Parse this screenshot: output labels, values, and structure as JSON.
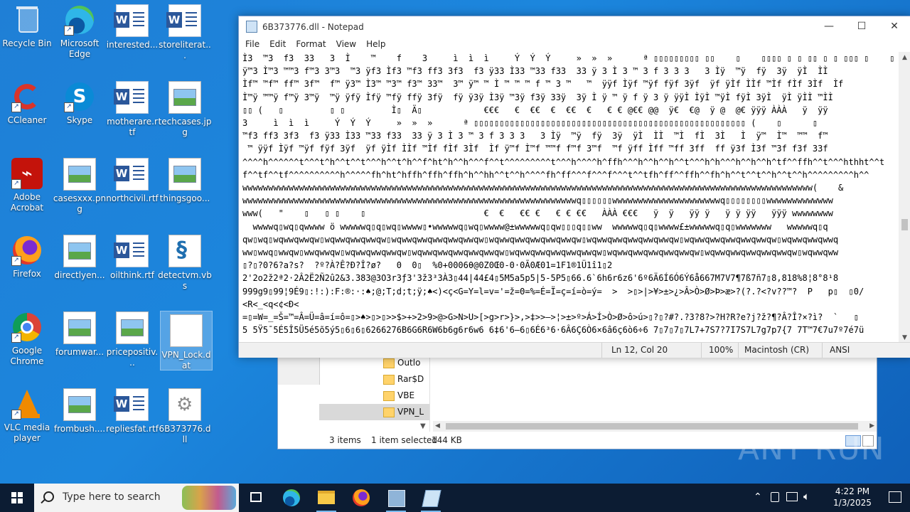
{
  "desktop": {
    "icons": [
      {
        "label": "Recycle Bin"
      },
      {
        "label": "Microsoft Edge"
      },
      {
        "label": "interested..."
      },
      {
        "label": "storeliterat..."
      },
      {
        "label": "CCleaner"
      },
      {
        "label": "Skype"
      },
      {
        "label": "motherare.rtf"
      },
      {
        "label": "techcases.jpg"
      },
      {
        "label": "Adobe Acrobat"
      },
      {
        "label": "casesxxx.png"
      },
      {
        "label": "northcivil.rtf"
      },
      {
        "label": "thingsgoo..."
      },
      {
        "label": "Firefox"
      },
      {
        "label": "directlyen..."
      },
      {
        "label": "oilthink.rtf"
      },
      {
        "label": "detectvm.vbs"
      },
      {
        "label": "Google Chrome"
      },
      {
        "label": "forumwar..."
      },
      {
        "label": "pricepositiv..."
      },
      {
        "label": "VPN_Lock.dat"
      },
      {
        "label": "VLC media player"
      },
      {
        "label": "frombush...."
      },
      {
        "label": "repliesfat.rtf"
      },
      {
        "label": "6B373776.dll"
      }
    ]
  },
  "notepad": {
    "title": "6B373776.dll - Notepad",
    "menu": [
      "File",
      "Edit",
      "Format",
      "View",
      "Help"
    ],
    "controls": {
      "minimize": "—",
      "maximize": "☐",
      "close": "✕"
    },
    "lines": [
      "Ì3  ™3  f3  33   3  Ì    ™    f    3     ì  ì  ì     Ý  Ý  Ý     »  »  »      ª ▯▯▯▯▯▯▯▯▯ ▯▯    ▯    ▯▯▯▯ ▯ ▯ ▯▯ ▯ ▯ ▯▯▯ ▯    ▯",
      "ÿ™3 Ì™3 ™™3 f™3 3™3  ™3 ÿf3 Ìf3 ™f3 ff3 3f3  f3 ÿ33 Ì33 ™33 f33  33 ÿ 3 Ì 3 ™ 3 f 3 3 3   3 Ìÿ  ™ÿ  fÿ  3ÿ  ÿÌ  ÌÌ",
      "Ìf™ ™f™ ff™ 3f™  f™ ÿ3™ Ì3™ ™3™ f3™ 33™  3™ ÿ™ ™ Ì ™ ™ ™ f ™ 3 ™   ™  ÿÿf Ìÿf ™ÿf fÿf 3ÿf  ÿf ÿÌf ÌÌf ™Ìf fÌf 3Ìf  Ìf",
      "Ì™ÿ ™™ÿ f™ÿ 3™ÿ  ™ÿ ÿfÿ Ìfÿ ™fÿ ffÿ 3fÿ  fÿ ÿ3ÿ Ì3ÿ ™3ÿ f3ÿ 33ÿ  3ÿ Ì ÿ ™ ÿ f ÿ 3 ÿ ÿÿÌ ÌÿÌ ™ÿÌ fÿÌ 3ÿÌ  ÿÌ ÿÌÌ ™ÌÌ",
      "▯▯ (   ▯         ▯ ▯         Ì▯  Ä▯            €€€   €  €€  €  €€  €   € € @€€ @@  ÿ€  €@  ÿ @  @€ ÿÿÿ ÀÀÀ   ÿ  ÿÿ",
      "3     ì  ì  ì     Ý  Ý  Ý     »  »  »      ª ▯▯▯▯▯▯▯▯▯▯▯▯▯▯▯▯▯▯▯▯▯▯▯▯▯▯▯▯▯▯▯▯▯▯▯▯▯▯▯▯▯▯▯▯▯▯▯▯▯▯▯▯▯ (    ▯      ▯",
      "™f3 ff3 3f3  f3 ÿ33 Ì33 ™33 f33  33 ÿ 3 Ì 3 ™ 3 f 3 3 3   3 Ìÿ  ™ÿ  fÿ  3ÿ  ÿÌ  ÌÌ  ™Ì  fÌ  3Ì   Ì  ÿ™  Ì™  ™™  f™",
      " ™ ÿÿf Ìÿf ™ÿf fÿf 3ÿf  ÿf ÿÌf ÌÌf ™Ìf fÌf 3Ìf  Ìf ÿ™f Ì™f ™™f f™f 3™f  ™f ÿff Ìff ™ff 3ff  ff ÿ3f Ì3f ™3f f3f 33f",
      "^^^^h^^^^^^t^^^t^h^^t^^t^^^h^^t^h^^f^ht^h^^h^^^f^^t^^^^^^^^^t^^^h^^^^h^ffh^^^h^^h^^h^^t^^^h^h^^^h^^h^^h^tf^^ffh^^t^^^hthht^^t",
      "f^^tf^^tf^^^^^^^^^^h^^^^^fh^ht^hffh^ffh^ffh^h^^hh^^t^^h^^^^fh^ff^^^f^^^f^^^t^^tfh^ff^^ffh^^fh^h^^t^^t^^h^^t^^h^^^^^^^^^h^^",
      "wwwwwwwwwwwwwwwwwwwwwwwwwwwwwwwwwwwwwwwwwwwwwwwwwwwwwwwwwwwwwwwwwwwwwwwwwwwwwwwwwwwwwwwwwwwwwwwwwwwwwwwwwwwwwww(    &",
      "wwwwwwwwwwwwwwwwwwwwwwwwwwwwwwwwwwwwwwwwwwwwwwwwwwwwwwwwwwwwwwwwwq▯▯▯▯▯▯wwwwwwwwwwwwwwwwwwwwwq▯▯▯▯▯▯▯▯wwwwwwwwwwwww",
      "www(   \"    ▯   ▯ ▯    ▯                       €  €   €€ €   € € €€   ÀÀÀ €€€   ÿ  ÿ   ÿÿ ÿ   ÿ ÿ ÿÿ   ÿÿÿ wwwwwwww",
      "  wwwwq▯wq▯qwwww ö wwwwwq▯q▯wq▯wwww▯•wwwwwq▯wq▯wwww@±wwwwwq▯qw▯▯▯q▯▯ww  wwwwwq▯q▯wwww£±wwwwwq▯q▯wwwwwww   wwwwwq▯q",
      "qw▯wq▯wqwwqwwqw▯wqwwqwwqwwqw▯wqwwqwwqwwqwwqwwqw▯wqwwqwwqwwqwwqwwqw▯wqwwqwwqwwqwwqwwqw▯wqwwqwwqwwqwwqwwqw▯wqwwqwwqwwq",
      "ww▯wwq▯wwqw▯wwqwwqw▯wqwwqwwqwwqw▯wqwwqwwqwwqwwqwwqw▯wqwwqwwqwwqwwqwwqw▯wqwwqwwqwwqwwqwwqw▯wqwwqwwqwwqwwqwwqw▯wqwwqww",
      "▯?▯?0?6?a?s?  ?º?À?Ê?Ð?Î?ø?   0  0▯  %0+0006θ@0Z0Œ0-0·0Ã0Æ01=1F1®1Ü1î1▯2",
      "2'2o2ž2ª2·2Â2Ë2Ñ2û2&3.383@3O3r3ƒ3'3ž3³3À3▯44|44£4▯5M5a5p5|5-5P5▯66.6`6h6r6z6'6º6Ä6Í6Ó6Ý6å667M7V7¶7ß7ñ7▯8,818%8¦8°8¹8",
      "999g9▯99¦9É9▯:!:):F:®:·:♠;@;T;d;t;ÿ;♠<)<ç<G=Y=l=v='=ž=Θ=%=É=Ï=ç=í=ò=ý=  >  >▯>|>¥>±>¿>Â>Ò>Ø>Þ>æ>?(?.?<?v??™?  P   p▯  ▯0/",
      "<R<_<q<¢<Ð<",
      "=▯=W=_=Š=™=Â=Ü=â=í=ô=▯>♠>▯>▯>>$>+>2>9>@>G>N>U>[>g>r>}>,>‡>>—>¦>±>º>Á>Í>Ò>Ø>ô>ú>▯?▯?#?.?3?8?>?H?R?e?j?ž?¶?Â?Î?×?ì?  `   ▯",
      "5 5Ÿ5¯5É5Î5Ü5é5õ5ý5▯6▯6▯6266276B6G6R6W6b6g6r6w6 6‡6'6—6▯6É6³6·6Â6Ç6Ò6×6â6ç6ò6÷6 7▯7▯7▯7L7+7S7?7I7S7L7g7p7{7 7T™7€7u7º7é7ü"
    ],
    "status": {
      "position": "Ln 12, Col 20",
      "zoom": "100%",
      "eol": "Macintosh (CR)",
      "encoding": "ANSI"
    }
  },
  "explorer": {
    "tree": [
      {
        "label": "Outlo"
      },
      {
        "label": "Rar$D"
      },
      {
        "label": "VBE"
      },
      {
        "label": "VPN_L"
      }
    ],
    "status": {
      "items": "3 items",
      "selected": "1 item selected",
      "size": "144 KB"
    }
  },
  "taskbar": {
    "search_placeholder": "Type here to search",
    "time": "4:22 PM",
    "date": "1/3/2025"
  },
  "watermark": "ANY RUN"
}
